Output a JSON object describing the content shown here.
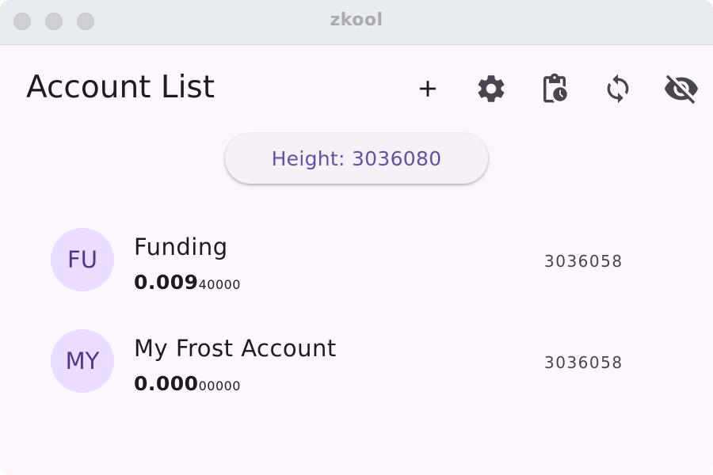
{
  "window": {
    "title": "zkool"
  },
  "header": {
    "title": "Account List",
    "actions": [
      {
        "icon": "plus-icon",
        "label": "Add account"
      },
      {
        "icon": "gear-icon",
        "label": "Settings"
      },
      {
        "icon": "clipboard-clock-icon",
        "label": "Pending"
      },
      {
        "icon": "sync-icon",
        "label": "Sync"
      },
      {
        "icon": "eye-off-icon",
        "label": "Hide"
      }
    ]
  },
  "height_chip": {
    "label": "Height: 3036080"
  },
  "accounts": [
    {
      "initials": "FU",
      "name": "Funding",
      "balance_main": "0.009",
      "balance_small": "40000",
      "height": "3036058"
    },
    {
      "initials": "MY",
      "name": "My Frost Account",
      "balance_main": "0.000",
      "balance_small": "00000",
      "height": "3036058"
    }
  ],
  "colors": {
    "accent": "#6750a4",
    "avatar_bg": "#eaddff",
    "surface": "#fdf6fd",
    "titlebar": "#e8ebef"
  }
}
